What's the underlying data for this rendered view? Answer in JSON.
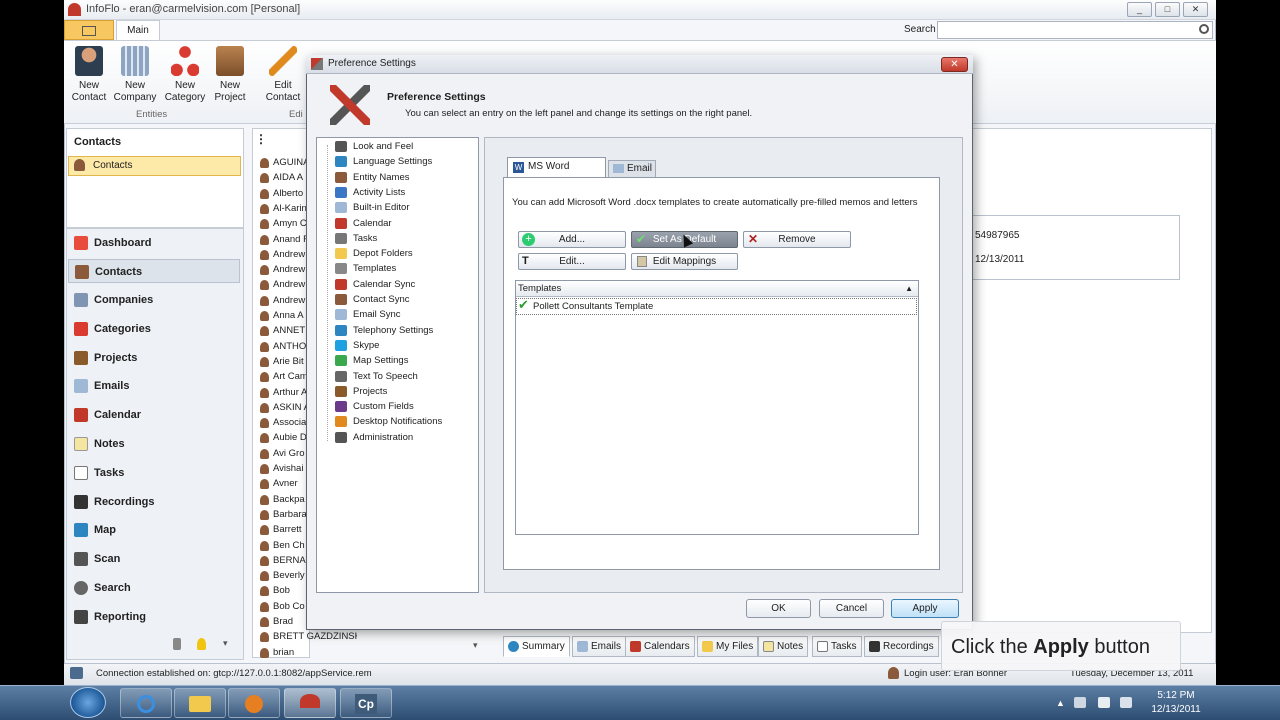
{
  "window": {
    "title": "InfoFlo - eran@carmelvision.com [Personal]",
    "search_label": "Search",
    "controls": [
      "_",
      "□",
      "✕"
    ]
  },
  "ribbon": {
    "app_menu_icon": "app-menu-icon",
    "tab_main": "Main",
    "buttons": [
      {
        "line1": "New",
        "line2": "Contact"
      },
      {
        "line1": "New",
        "line2": "Company"
      },
      {
        "line1": "New",
        "line2": "Category"
      },
      {
        "line1": "New",
        "line2": "Project"
      },
      {
        "line1": "Edit",
        "line2": "Contact"
      }
    ],
    "group_entities": "Entities",
    "group_edit": "Edi"
  },
  "left": {
    "header": "Contacts",
    "selected_item": "Contacts",
    "nav": [
      "Dashboard",
      "Contacts",
      "Companies",
      "Categories",
      "Projects",
      "Emails",
      "Calendar",
      "Notes",
      "Tasks",
      "Recordings",
      "Map",
      "Scan",
      "Search",
      "Reporting"
    ]
  },
  "contacts": [
    "AGUINA",
    "AIDA A",
    "Alberto",
    "Al-Karin",
    "Amyn C",
    "Anand F",
    "Andrew",
    "Andrew",
    "Andrew",
    "Andrew",
    "Anna A",
    "ANNET",
    "ANTHO",
    "Arie Bit",
    "Art Cam",
    "Arthur A",
    "ASKIN A",
    "Associa",
    "Aubie D",
    "Avi Gro",
    "Avishai",
    "Avner",
    "Backpa",
    "Barbara",
    "Barrett",
    "Ben Ch",
    "BERNAD",
    "Beverly",
    "Bob",
    "Bob Co",
    "Brad",
    "BRETT GAZDZINSKI",
    "brian"
  ],
  "right_panel": {
    "phone": "54987965",
    "date": "12/13/2011"
  },
  "dialog": {
    "title": "Preference Settings",
    "header_title": "Preference Settings",
    "header_subtitle": "You can select an entry on the left panel and change its settings on the right panel.",
    "tree": [
      "Look and Feel",
      "Language Settings",
      "Entity Names",
      "Activity Lists",
      "Built-in Editor",
      "Calendar",
      "Tasks",
      "Depot Folders",
      "Templates",
      "Calendar Sync",
      "Contact Sync",
      "Email Sync",
      "Telephony Settings",
      "Skype",
      "Map Settings",
      "Text To Speech",
      "Projects",
      "Custom Fields",
      "Desktop Notifications",
      "Administration"
    ],
    "tabs": {
      "word": "MS Word Memos",
      "email": "Email"
    },
    "description": "You can add Microsoft Word .docx templates to create automatically pre-filled memos and letters",
    "buttons": {
      "add": "Add...",
      "set_default": "Set As Default",
      "remove": "Remove",
      "edit": "Edit...",
      "edit_mappings": "Edit Mappings"
    },
    "list_header": "Templates",
    "templates": [
      "Pollett Consultants Template"
    ],
    "footer": {
      "ok": "OK",
      "cancel": "Cancel",
      "apply": "Apply"
    }
  },
  "bottom_tabs": [
    "Summary",
    "Emails",
    "Calendars",
    "My Files",
    "Notes",
    "Tasks",
    "Recordings"
  ],
  "callout": {
    "prefix": "Click the ",
    "bold": "Apply",
    "suffix": " button"
  },
  "status": {
    "connection": "Connection established on: gtcp://127.0.0.1:8082/appService.rem",
    "login": "Login user: Eran Bonner",
    "date_text": "Tuesday, December 13, 2011"
  },
  "taskbar": {
    "time": "5:12 PM",
    "date": "12/13/2011"
  },
  "colors": {
    "accent_orange": "#f7c862",
    "selection": "#fde9a8",
    "title_red": "#c0392b"
  }
}
